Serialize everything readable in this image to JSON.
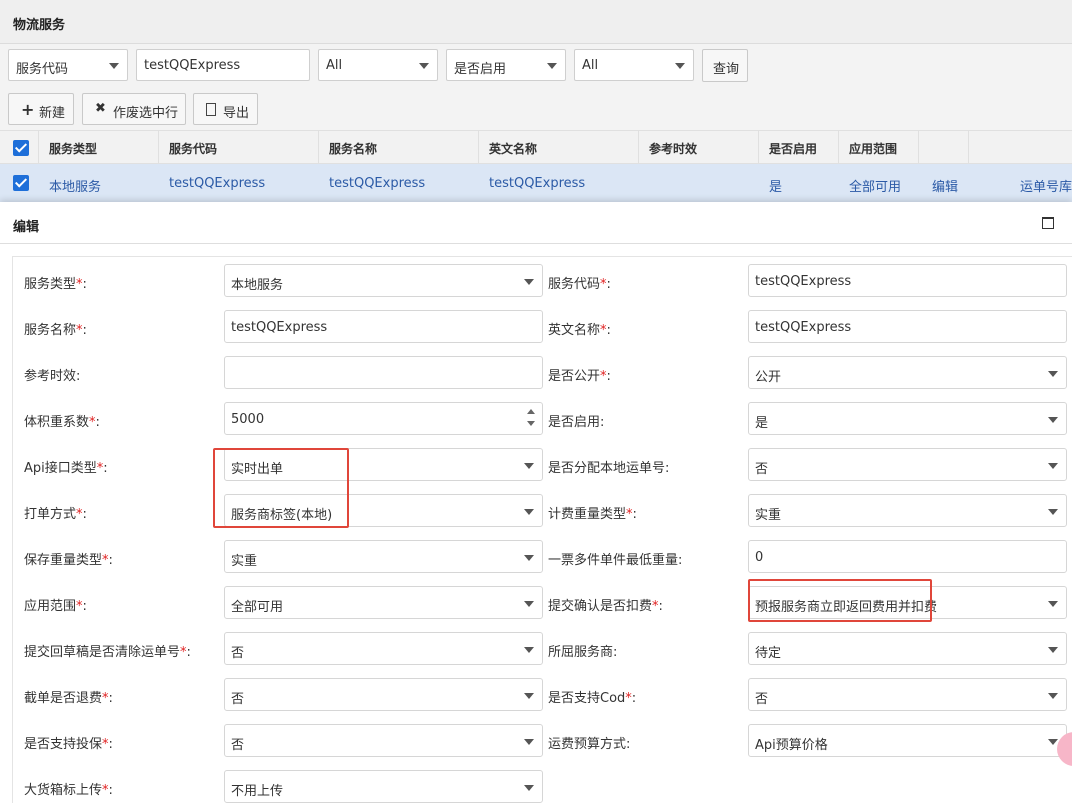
{
  "page_title": "物流服务",
  "filters": {
    "field_select": "服务代码",
    "search_value": "testQQExpress",
    "select_2": "All",
    "enabled_select": "是否启用",
    "select_4": "All",
    "query_button": "查询"
  },
  "toolbar": {
    "new_label": "新建",
    "void_label": "作废选中行",
    "export_label": "导出"
  },
  "grid": {
    "headers": [
      "服务类型",
      "服务代码",
      "服务名称",
      "英文名称",
      "参考时效",
      "是否启用",
      "应用范围"
    ],
    "row": {
      "type": "本地服务",
      "code": "testQQExpress",
      "name": "testQQExpress",
      "en_name": "testQQExpress",
      "timeliness": "",
      "enabled": "是",
      "scope": "全部可用",
      "edit_link": "编辑",
      "waybill_link": "运单号库"
    }
  },
  "dialog": {
    "title": "编辑",
    "required_mark": "*",
    "fields": {
      "service_type": {
        "label": "服务类型",
        "value": "本地服务"
      },
      "service_code": {
        "label": "服务代码",
        "value": "testQQExpress"
      },
      "service_name": {
        "label": "服务名称",
        "value": "testQQExpress"
      },
      "en_name": {
        "label": "英文名称",
        "value": "testQQExpress"
      },
      "timeliness": {
        "label": "参考时效",
        "value": ""
      },
      "is_public": {
        "label": "是否公开",
        "value": "公开"
      },
      "volume_factor": {
        "label": "体积重系数",
        "value": "5000"
      },
      "is_enabled": {
        "label": "是否启用",
        "value": "是"
      },
      "api_type": {
        "label": "Api接口类型",
        "value": "实时出单"
      },
      "assign_local_no": {
        "label": "是否分配本地运单号",
        "value": "否"
      },
      "print_method": {
        "label": "打单方式",
        "value": "服务商标签(本地)"
      },
      "billing_weight_type": {
        "label": "计费重量类型",
        "value": "实重"
      },
      "save_weight_type": {
        "label": "保存重量类型",
        "value": "实重"
      },
      "min_piece_weight": {
        "label": "一票多件单件最低重量",
        "value": "0"
      },
      "scope": {
        "label": "应用范围",
        "value": "全部可用"
      },
      "submit_deduct": {
        "label": "提交确认是否扣费",
        "value": "预报服务商立即返回费用并扣费"
      },
      "clear_waybill": {
        "label": "提交回草稿是否清除运单号",
        "value": "否"
      },
      "provider": {
        "label": "所屈服务商",
        "value": "待定"
      },
      "refund_on_intercept": {
        "label": "截单是否退费",
        "value": "否"
      },
      "support_cod": {
        "label": "是否支持Cod",
        "value": "否"
      },
      "support_insurance": {
        "label": "是否支持投保",
        "value": "否"
      },
      "freight_estimate": {
        "label": "运费预算方式",
        "value": "Api预算价格"
      },
      "big_box_upload": {
        "label": "大货箱标上传",
        "value": "不用上传"
      }
    }
  },
  "colors": {
    "accent": "#1e6fd9",
    "selected_row": "#dbe6f5",
    "link": "#2b5aa6",
    "highlight": "#e0463a",
    "required": "#e02020"
  }
}
